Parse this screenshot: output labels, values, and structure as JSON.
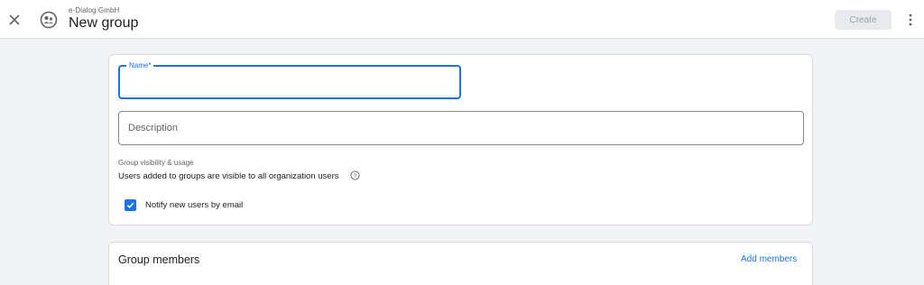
{
  "header": {
    "org_name": "e-Dialog GmbH",
    "title": "New group",
    "create_label": "Create",
    "close_icon": "close-icon",
    "org_icon": "group-icon",
    "more_icon": "more-vert-icon"
  },
  "form": {
    "name_label": "Name*",
    "name_value": "",
    "description_placeholder": "Description",
    "description_value": "",
    "visibility_heading": "Group visibility & usage",
    "visibility_text": "Users added to groups are visible to all organization users",
    "notify_label": "Notify new users by email",
    "notify_checked": true
  },
  "members": {
    "title": "Group members",
    "add_label": "Add members"
  },
  "colors": {
    "accent": "#1a73e8",
    "background": "#f1f3f4",
    "disabled_button": "#e8eaed"
  }
}
